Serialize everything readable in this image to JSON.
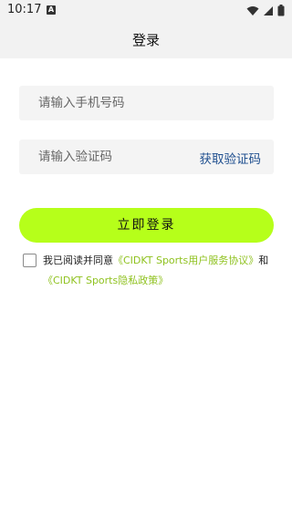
{
  "status_bar": {
    "time": "10:17",
    "notification_glyph": "A",
    "icons": [
      "wifi-icon",
      "signal-icon",
      "battery-icon"
    ]
  },
  "header": {
    "title": "登录"
  },
  "form": {
    "phone_placeholder": "请输入手机号码",
    "code_placeholder": "请输入验证码",
    "get_code_label": "获取验证码",
    "login_label": "立即登录"
  },
  "agreement": {
    "checked": false,
    "prefix": "我已阅读并同意",
    "user_agreement": "《CIDKT Sports用户服务协议》",
    "conjunction": "和",
    "privacy_policy": "《CIDKT Sports隐私政策》"
  },
  "colors": {
    "accent_button": "#b6ff1a",
    "link_green": "#8fc21f",
    "link_blue": "#1f4f8f",
    "header_bg": "#f2f2f2"
  }
}
